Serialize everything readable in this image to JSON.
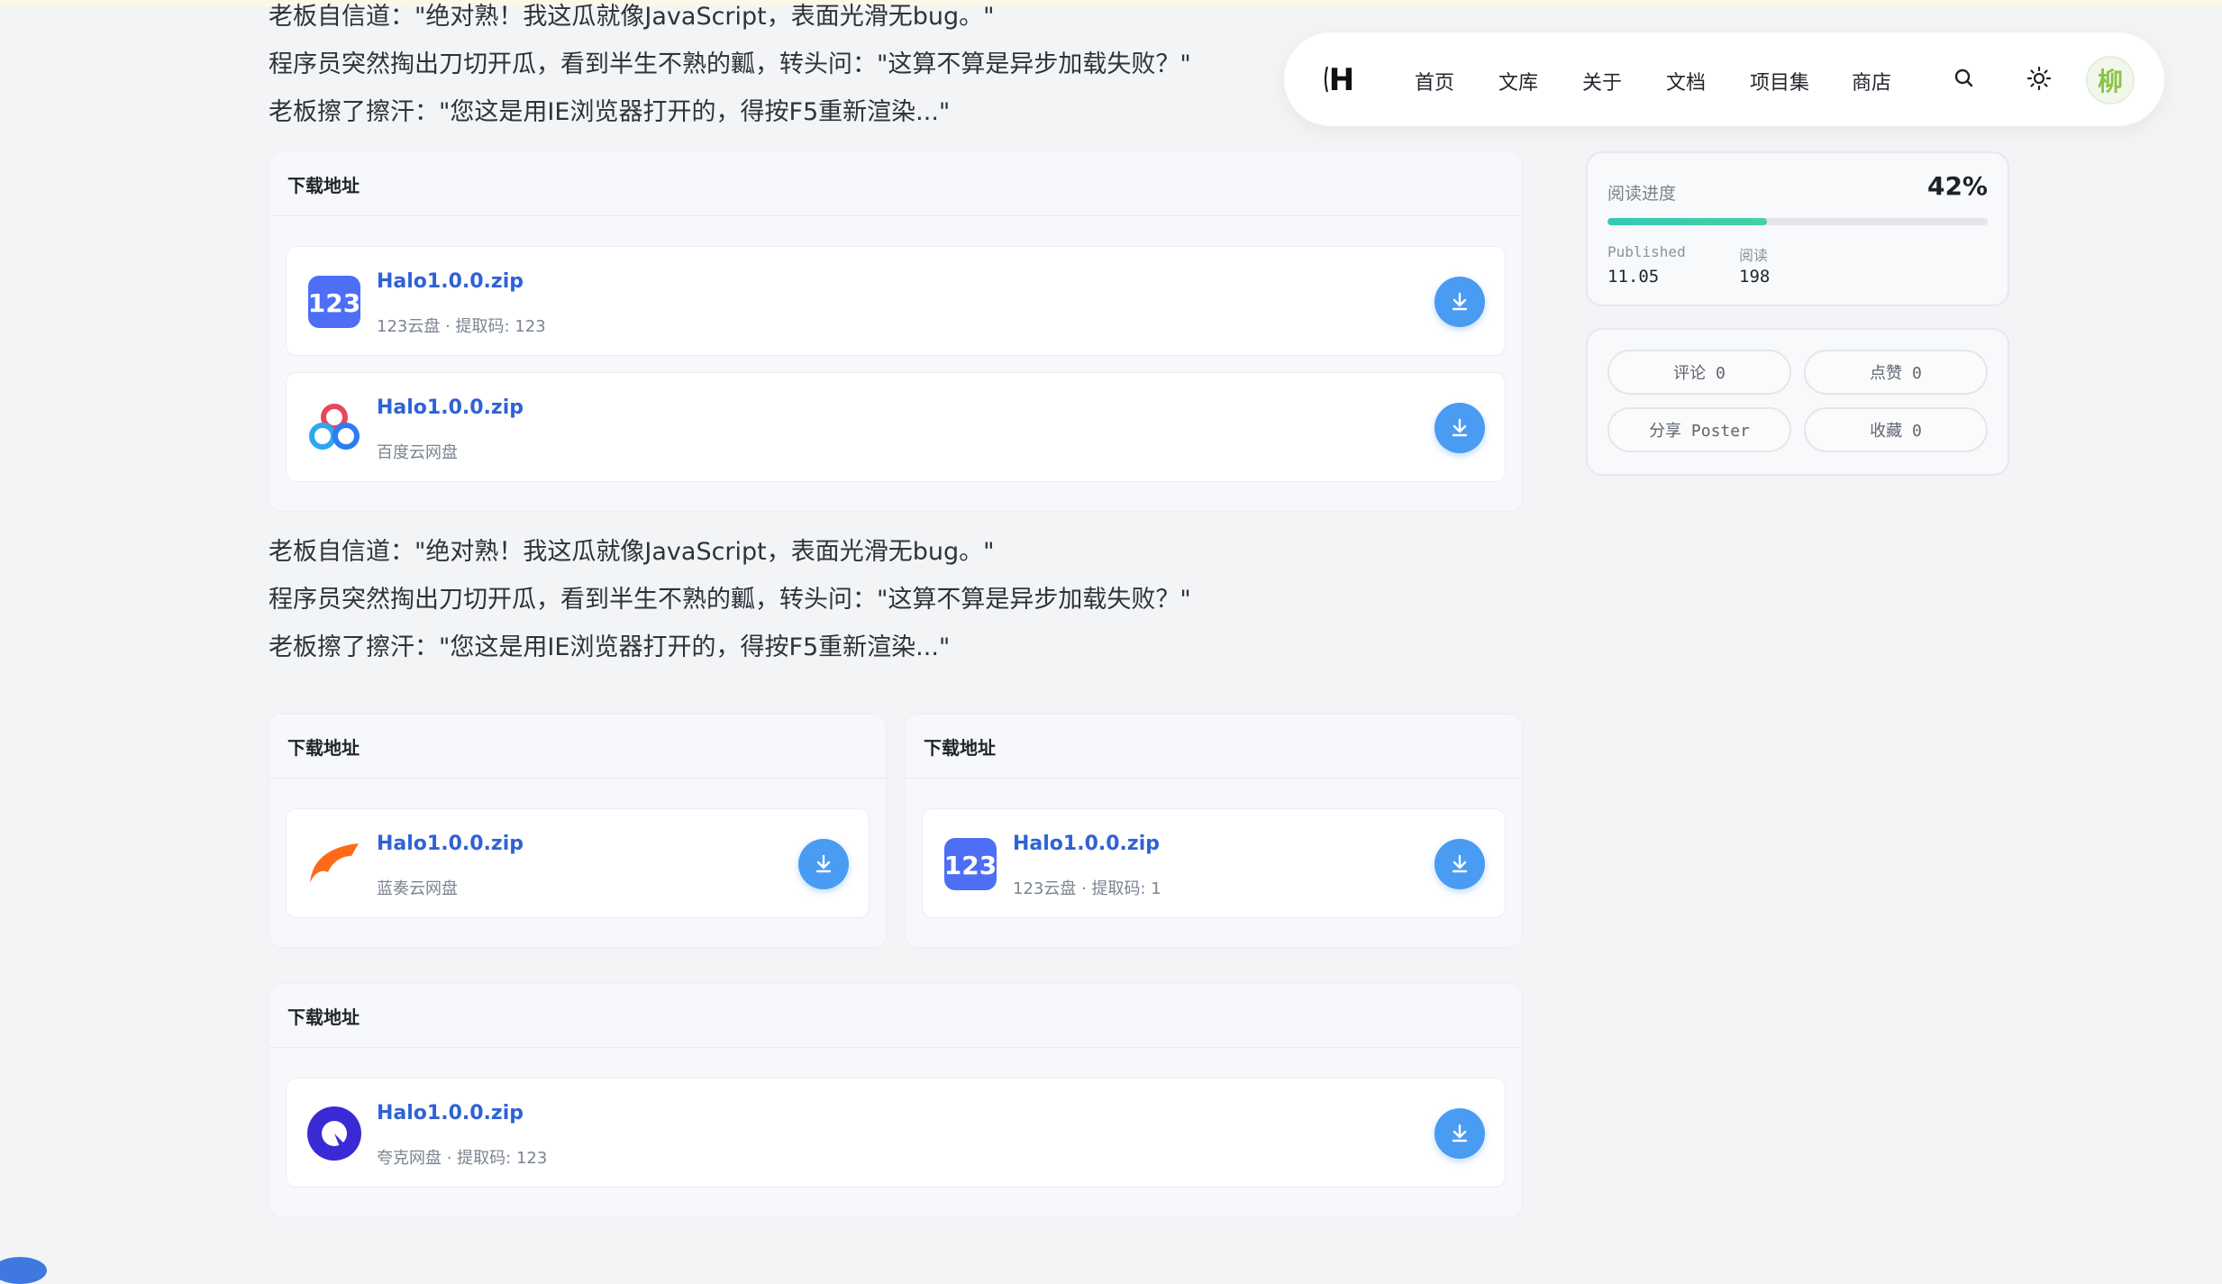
{
  "article": {
    "top_lines": [
      "老板自信道：\"绝对熟！我这瓜就像JavaScript，表面光滑无bug。\"",
      "程序员突然掏出刀切开瓜，看到半生不熟的瓤，转头问：\"这算不算是异步加载失败？\"",
      "老板擦了擦汗：\"您这是用IE浏览器打开的，得按F5重新渲染...\""
    ],
    "mid_lines": [
      "老板自信道：\"绝对熟！我这瓜就像JavaScript，表面光滑无bug。\"",
      "程序员突然掏出刀切开瓜，看到半生不熟的瓤，转头问：\"这算不算是异步加载失败？\"",
      "老板擦了擦汗：\"您这是用IE浏览器打开的，得按F5重新渲染...\""
    ]
  },
  "downloads": {
    "block1": {
      "title": "下载地址",
      "items": [
        {
          "name": "Halo1.0.0.zip",
          "meta": "123云盘 · 提取码: 123",
          "icon": "123pan-icon"
        },
        {
          "name": "Halo1.0.0.zip",
          "meta": "百度云网盘",
          "icon": "baidu-netdisk-icon"
        }
      ]
    },
    "block2": {
      "title": "下载地址",
      "items": [
        {
          "name": "Halo1.0.0.zip",
          "meta": "蓝奏云网盘",
          "icon": "lanzou-icon"
        }
      ]
    },
    "block3": {
      "title": "下载地址",
      "items": [
        {
          "name": "Halo1.0.0.zip",
          "meta": "123云盘 · 提取码: 1",
          "icon": "123pan-icon"
        }
      ]
    },
    "block4": {
      "title": "下载地址",
      "items": [
        {
          "name": "Halo1.0.0.zip",
          "meta": "夸克网盘 · 提取码: 123",
          "icon": "quark-icon"
        }
      ]
    }
  },
  "nav": {
    "logo_letter": "H",
    "items": [
      "首页",
      "文库",
      "关于",
      "文档",
      "项目集",
      "商店"
    ],
    "avatar_text": "柳"
  },
  "sidebar": {
    "progress_label": "阅读进度",
    "progress_value": "42%",
    "progress_fraction": 0.42,
    "published_label": "Published",
    "published_value": "11.05",
    "reads_label": "阅读",
    "reads_value": "198",
    "actions": {
      "comment": "评论 0",
      "like": "点赞 0",
      "share": "分享 Poster",
      "favorite": "收藏 0"
    }
  },
  "colors": {
    "accent": "#2f62d6",
    "download_button": "#4a9bf2",
    "progress": "#35c8b5"
  }
}
